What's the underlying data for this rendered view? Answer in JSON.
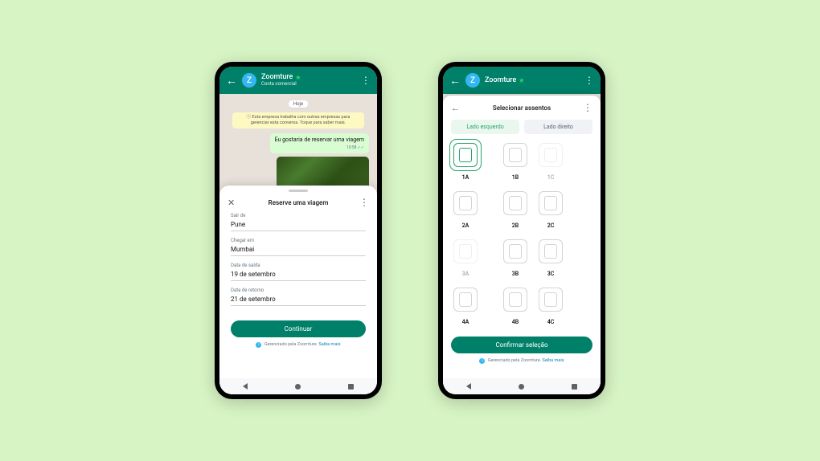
{
  "header": {
    "business_name": "Zoomture",
    "account_type": "Conta comercial",
    "avatar_letter": "Z"
  },
  "chat": {
    "date_label": "Hoje",
    "system_message": "Esta empresa trabalha com outras empresas para gerenciar esta conversa. Toque para saber mais.",
    "user_message": "Eu gostaria de reservar uma viagem",
    "user_message_time": "10:58 ✓✓"
  },
  "booking_sheet": {
    "title": "Reserve uma viagem",
    "fields": {
      "depart_from_label": "Sair de",
      "depart_from_value": "Pune",
      "arrive_at_label": "Chegar em",
      "arrive_at_value": "Mumbai",
      "depart_date_label": "Data de saída",
      "depart_date_value": "19 de setembro",
      "return_date_label": "Data de retorno",
      "return_date_value": "21 de setembro"
    },
    "continue_label": "Continuar"
  },
  "seat_sheet": {
    "title": "Selecionar assentos",
    "tab_left": "Lado esquerdo",
    "tab_right": "Lado direito",
    "seats": {
      "r1a": "1A",
      "r1b": "1B",
      "r1c": "1C",
      "r2a": "2A",
      "r2b": "2B",
      "r2c": "2C",
      "r3a": "3A",
      "r3b": "3B",
      "r3c": "3C",
      "r4a": "4A",
      "r4b": "4B",
      "r4c": "4C"
    },
    "confirm_label": "Confirmar seleção"
  },
  "footer": {
    "managed_text": "Gerenciado pela Zoomture.",
    "learn_more": "Saiba mais"
  }
}
